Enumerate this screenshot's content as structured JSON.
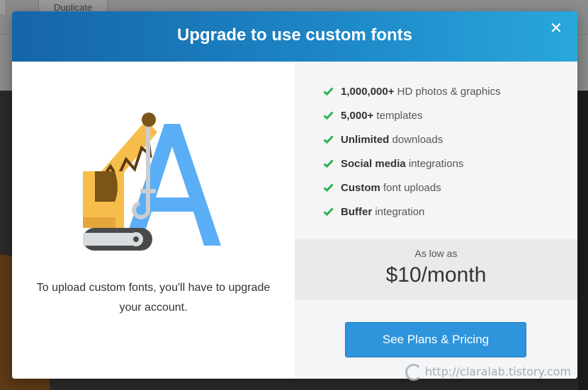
{
  "background": {
    "toolbar_button_label": "Duplicate"
  },
  "modal": {
    "title": "Upgrade to use custom fonts",
    "close_icon": "close-icon",
    "left": {
      "message": "To upload custom fonts, you'll have to upgrade your account."
    },
    "features": [
      {
        "bold": "1,000,000+",
        "rest": " HD photos & graphics"
      },
      {
        "bold": "5,000+",
        "rest": " templates"
      },
      {
        "bold": "Unlimited",
        "rest": " downloads"
      },
      {
        "bold": "Social media",
        "rest": " integrations"
      },
      {
        "bold": "Custom",
        "rest": " font uploads"
      },
      {
        "bold": "Buffer",
        "rest": " integration"
      }
    ],
    "price": {
      "caption": "As low as",
      "value": "$10/month"
    },
    "cta_label": "See Plans & Pricing"
  },
  "watermark": "http://claralab.tistory.com",
  "colors": {
    "header_start": "#1565a8",
    "header_end": "#29a7dc",
    "check": "#2bb24c",
    "cta": "#2e95dd",
    "letter_a": "#5aaef5",
    "crane_yellow": "#f7bd4a"
  }
}
